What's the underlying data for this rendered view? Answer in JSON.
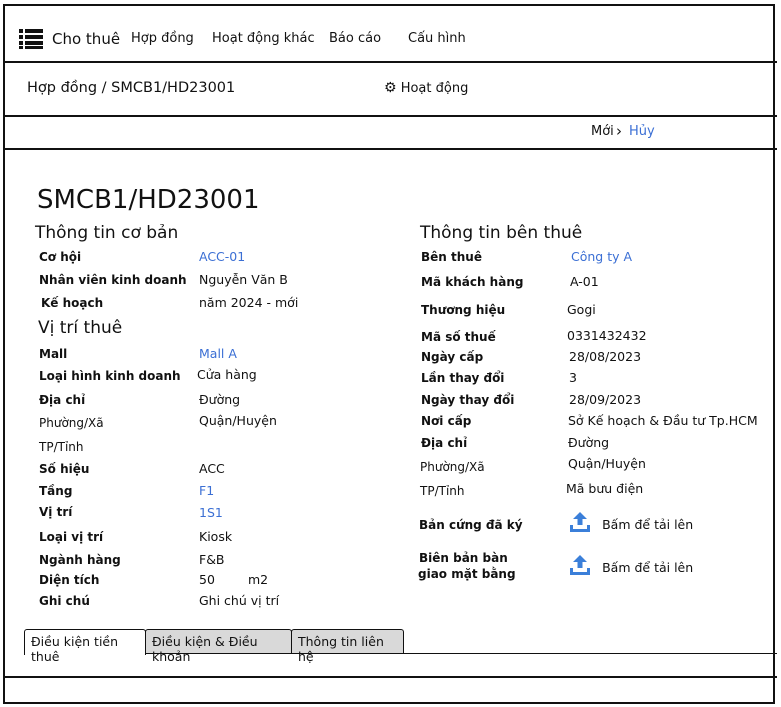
{
  "nav": {
    "items": [
      "Cho thuê",
      "Hợp đồng",
      "Hoạt động khác",
      "Báo cáo",
      "Cấu hình"
    ]
  },
  "header": {
    "breadcrumb": "Hợp đồng / SMCB1/HD23001",
    "activity_label": "Hoạt động"
  },
  "actions": {
    "new_label": "Mới",
    "cancel_label": "Hủy"
  },
  "title": "SMCB1/HD23001",
  "basic": {
    "heading": "Thông tin cơ bản",
    "co_hoi_label": "Cơ hội",
    "co_hoi": "ACC-01",
    "nvkd_label": "Nhân viên kinh doanh",
    "nvkd": "Nguyễn Văn B",
    "ke_hoach_label": "Kế hoạch",
    "ke_hoach": "năm 2024 - mới"
  },
  "location": {
    "heading": "Vị trí thuê",
    "mall_label": "Mall",
    "mall": "Mall A",
    "loai_hinh_label": "Loại hình kinh doanh",
    "loai_hinh": "Cửa hàng",
    "dia_chi_label": "Địa chỉ",
    "dia_chi": "Đường",
    "phuong_label": "Phường/Xã",
    "quan": "Quận/Huyện",
    "tp_label": "TP/Tỉnh",
    "so_hieu_label": "Số hiệu",
    "so_hieu": "ACC",
    "tang_label": "Tầng",
    "tang": "F1",
    "vi_tri_label": "Vị trí",
    "vi_tri": "1S1",
    "loai_vi_tri_label": "Loại vị trí",
    "loai_vi_tri": "Kiosk",
    "nganh_hang_label": "Ngành hàng",
    "nganh_hang": "F&B",
    "dien_tich_label": "Diện tích",
    "dien_tich": "50",
    "dien_tich_unit": "m2",
    "ghi_chu_label": "Ghi chú",
    "ghi_chu": "Ghi chú vị trí"
  },
  "tenant": {
    "heading": "Thông tin bên thuê",
    "ben_thue_label": "Bên thuê",
    "ben_thue": "Công ty A",
    "ma_kh_label": "Mã khách hàng",
    "ma_kh": "A-01",
    "thuong_hieu_label": "Thương hiệu",
    "thuong_hieu": "Gogi",
    "mst_label": "Mã số thuế",
    "mst": "0331432432",
    "ngay_cap_label": "Ngày cấp",
    "ngay_cap": "28/08/2023",
    "lan_thay_doi_label": "Lần thay đổi",
    "lan_thay_doi": "3",
    "ngay_thay_doi_label": "Ngày thay đổi",
    "ngay_thay_doi": "28/09/2023",
    "noi_cap_label": "Nơi cấp",
    "noi_cap": "Sở Kế hoạch & Đầu tư Tp.HCM",
    "dia_chi_label": "Địa chỉ",
    "dia_chi": "Đường",
    "phuong_label": "Phường/Xã",
    "quan": "Quận/Huyện",
    "tp_label": "TP/Tỉnh",
    "ma_buu_dien": "Mã bưu điện",
    "ban_cung_label": "Bản cứng đã ký",
    "upload_label": "Bấm để tải lên",
    "bien_ban_line1": "Biên bản bàn",
    "bien_ban_line2": "giao mặt bằng",
    "upload_label2": "Bấm để tải lên"
  },
  "tabs": [
    "Điều kiện tiền thuê",
    "Điều kiện & Điều khoản",
    "Thông tin liên hệ"
  ],
  "colors": {
    "link": "#3b6fd4",
    "upload_icon": "#3b7fd9"
  }
}
